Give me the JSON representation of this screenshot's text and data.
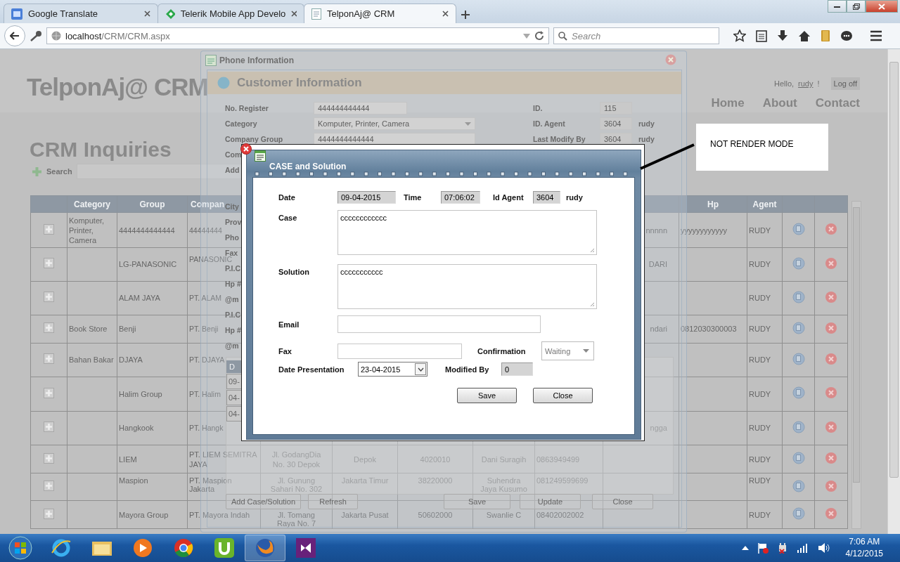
{
  "browser": {
    "tabs": [
      {
        "title": "Google Translate",
        "selected": false
      },
      {
        "title": "Telerik Mobile App Develo",
        "selected": false
      },
      {
        "title": "TelponAj@ CRM",
        "selected": true
      }
    ],
    "address": {
      "host": "localhost",
      "path": "/CRM/CRM.aspx"
    },
    "search": {
      "placeholder": "Search"
    }
  },
  "page": {
    "logo": "TelponAj@ CRM",
    "greeting": "Hello,",
    "user": "rudy",
    "greeting_end": "!",
    "logoff": "Log off",
    "nav": [
      "Home",
      "About",
      "Contact"
    ],
    "heading": "CRM Inquiries",
    "search_label": "Search",
    "table": {
      "headers": {
        "category": "Category",
        "group": "Group",
        "company": "Compan",
        "hp": "Hp",
        "agent": "Agent"
      },
      "rows": [
        {
          "category": "Komputer, Printer, Camera",
          "group": "4444444444444",
          "company": "44444444",
          "column_10": "nnnnn",
          "hp": "yyyyyyyyyyyy",
          "agent": "RUDY"
        },
        {
          "group": "LG-PANASONIC",
          "company": "PANASONIC",
          "column_10": "DARI",
          "agent": "RUDY"
        },
        {
          "group": "ALAM JAYA",
          "company": "PT. ALAM",
          "agent": "RUDY"
        },
        {
          "category": "Book Store",
          "group": "Benji",
          "company": "PT. Benji",
          "column_10": "ndari",
          "hp": "0812030300003",
          "agent": "RUDY"
        },
        {
          "category": "Bahan Bakar",
          "group": "DJAYA",
          "company": "PT. DJAYA",
          "agent": "RUDY"
        },
        {
          "group": "Halim Group",
          "company": "PT. Halim",
          "agent": "RUDY"
        },
        {
          "group": "Hangkook",
          "company": "PT. Hangk",
          "column_10": "ngga",
          "agent": "RUDY"
        },
        {
          "group": "LIEM",
          "company": "PT. LIEM SEMITRA JAYA",
          "column_5": "Jl. GodangDia No. 30 Depok",
          "column_6": "Depok",
          "column_7": "4020010",
          "column_8": "Dani Suragih",
          "column_9": "0863949499",
          "agent": "RUDY"
        },
        {
          "group": "Maspion",
          "company": "PT. Maspion Jakarta",
          "column_5": "Jl. Gunung Sahari No. 302",
          "column_6": "Jakarta Timur",
          "column_7": "38220000",
          "column_8": "Suhendra Jaya Kusumo",
          "column_9": "081249599699",
          "agent": "RUDY"
        },
        {
          "group": "Mayora Group",
          "company": "PT. Mayora Indah",
          "column_5": "Jl. Tomang Raya No. 7",
          "column_6": "Jakarta Pusat",
          "column_7": "50602000",
          "column_8": "Swanlie C",
          "column_9": "08402002002",
          "agent": "RUDY"
        }
      ]
    }
  },
  "phone_window": {
    "title": "Phone Information",
    "section_title": "Customer Information",
    "fields_left": [
      {
        "label": "No. Register",
        "value": "444444444444",
        "kind": "text"
      },
      {
        "label": "Category",
        "value": "Komputer, Printer, Camera",
        "kind": "select"
      },
      {
        "label": "Company Group",
        "value": "4444444444444",
        "kind": "wide"
      },
      {
        "label": "Com",
        "kind": "label"
      },
      {
        "label": "Add",
        "kind": "label"
      }
    ],
    "labels_lower": [
      "City",
      "Prov",
      "Pho",
      "Fax",
      "P.I.C",
      "Hp #",
      "@m",
      "P.I.C",
      "Hp #",
      "@m"
    ],
    "fields_right": [
      {
        "label": "ID.",
        "value": "115"
      },
      {
        "label": "ID. Agent",
        "value": "3604",
        "note": "rudy"
      },
      {
        "label": "Last Modify By",
        "value": "3604",
        "note": "rudy"
      }
    ],
    "grid": {
      "header": "D",
      "rows": [
        "09-",
        "04-",
        "04-"
      ]
    },
    "buttons": [
      "Add Case/Solution",
      "Refresh",
      "Save",
      "Update",
      "Close"
    ]
  },
  "case_dialog": {
    "title": "CASE and Solution",
    "date": {
      "label": "Date",
      "value": "09-04-2015"
    },
    "time": {
      "label": "Time",
      "value": "07:06:02"
    },
    "agent": {
      "label": "Id Agent",
      "value": "3604",
      "name": "rudy"
    },
    "case": {
      "label": "Case",
      "value": "cccccccccccc"
    },
    "solution": {
      "label": "Solution",
      "value": "ccccccccccc"
    },
    "email": {
      "label": "Email"
    },
    "fax": {
      "label": "Fax"
    },
    "confirmation": {
      "label": "Confirmation",
      "value": "Waiting"
    },
    "date_presentation": {
      "label": "Date Presentation",
      "value": "23-04-2015"
    },
    "modified_by": {
      "label": "Modified By",
      "value": "0"
    },
    "buttons": [
      "Save",
      "Close"
    ]
  },
  "annotation": "NOT RENDER MODE",
  "taskbar": {
    "time": "7:06 AM",
    "date": "4/12/2015"
  }
}
